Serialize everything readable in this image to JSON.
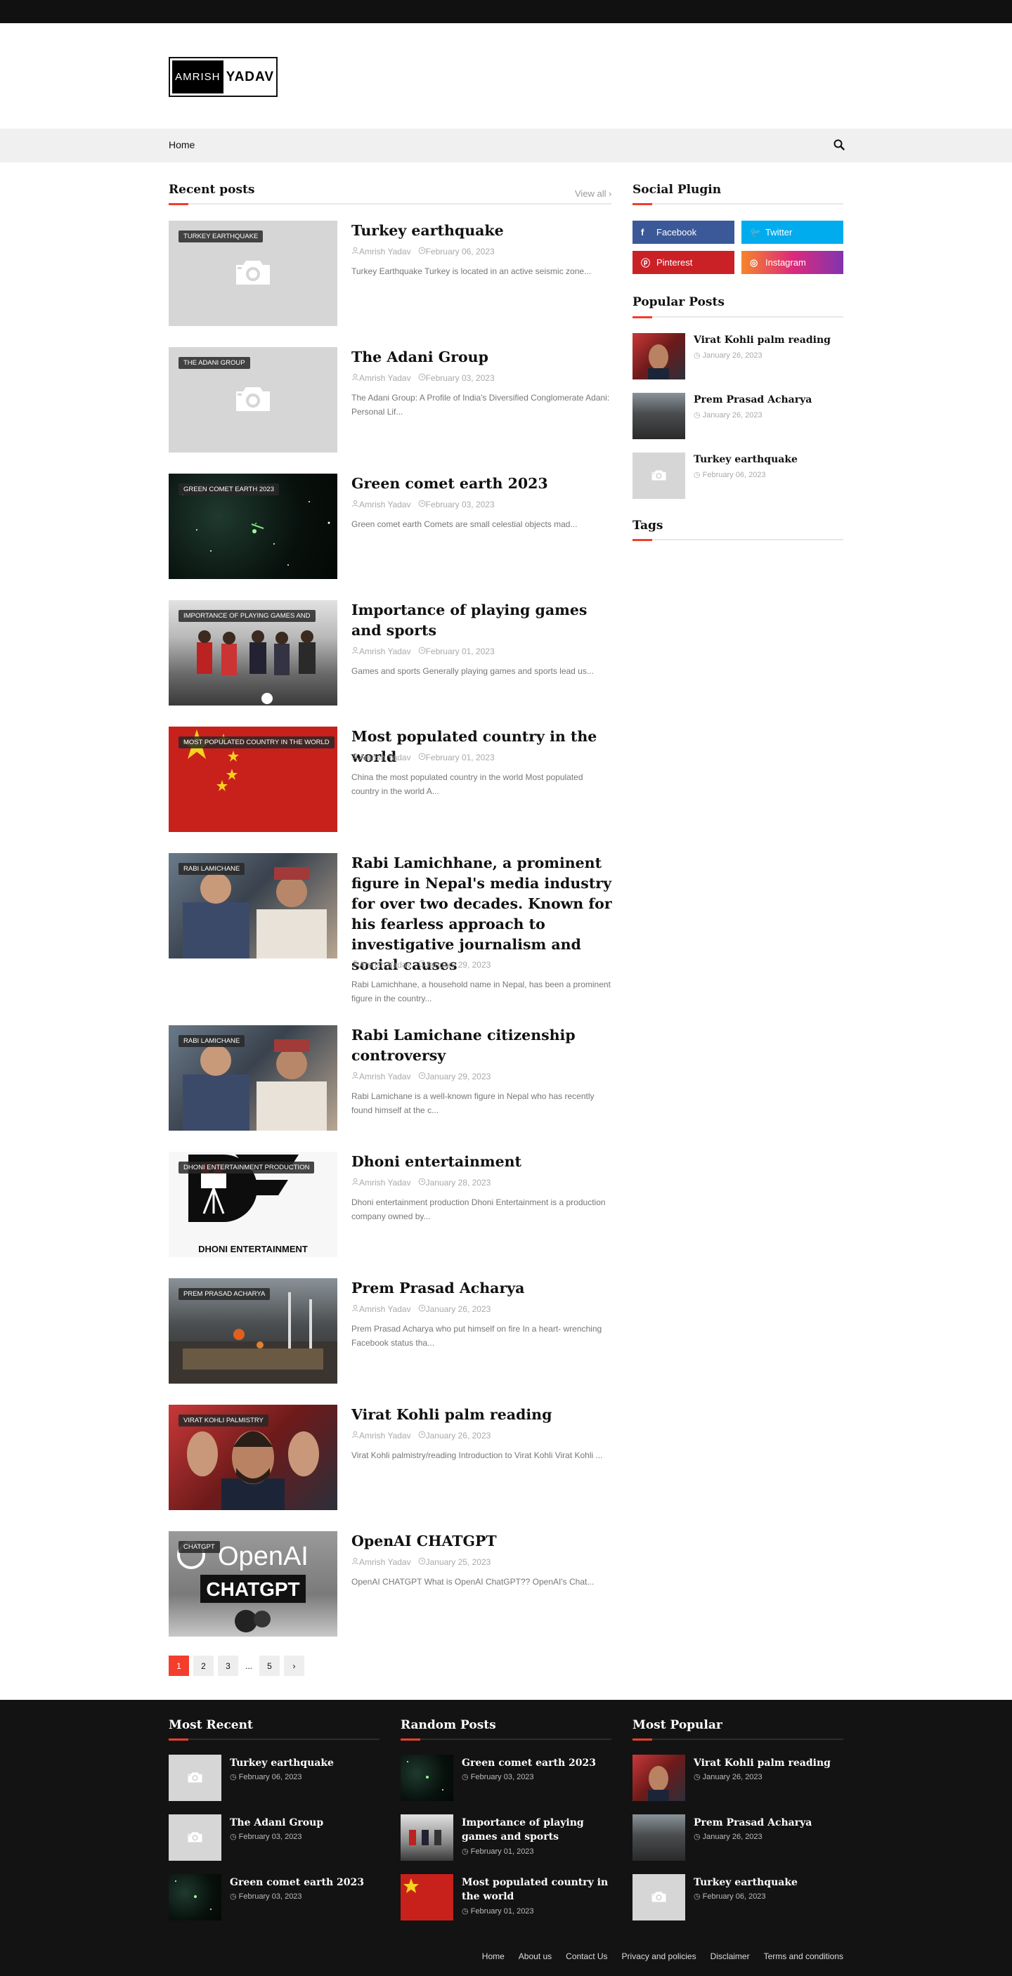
{
  "header": {
    "logo_part1": "AMRISH",
    "logo_part2": "YADAV"
  },
  "nav": {
    "home": "Home",
    "search_icon": "search-icon"
  },
  "recent": {
    "title": "Recent posts",
    "view_all": "View all",
    "posts": [
      {
        "badge": "Turkey earthquake",
        "title": "Turkey earthquake",
        "author": "Amrish Yadav",
        "date": "February 06, 2023",
        "excerpt": "Turkey Earthquake  Turkey is located in an active seismic zone..."
      },
      {
        "badge": "The Adani Group",
        "title": "The Adani Group",
        "author": "Amrish Yadav",
        "date": "February 03, 2023",
        "excerpt": "The Adani Group: A Profile of India's Diversified Conglomerate Adani: Personal Lif..."
      },
      {
        "badge": "Green comet earth 2023",
        "title": "Green comet earth 2023",
        "author": "Amrish Yadav",
        "date": "February 03, 2023",
        "excerpt": "Green comet earth   Comets are small celestial objects mad..."
      },
      {
        "badge": "Importance of playing games and",
        "title": "Importance of playing games and sports",
        "author": "Amrish Yadav",
        "date": "February 01, 2023",
        "excerpt": "Games and sports    Generally playing games and sports lead us..."
      },
      {
        "badge": "Most populated country in the world",
        "title": "Most populated country in the world",
        "author": "Amrish Yadav",
        "date": "February 01, 2023",
        "excerpt": "China the most populated country in the world  Most populated country in the world A..."
      },
      {
        "badge": "Rabi Lamichane",
        "title": "Rabi Lamichhane, a prominent figure in Nepal's media industry for over two decades. Known for his fearless approach to investigative journalism and social causes",
        "author": "Amrish Yadav",
        "date": "January 29, 2023",
        "excerpt": "Rabi Lamichhane, a household name in Nepal, has been a prominent figure in the country..."
      },
      {
        "badge": "Rabi Lamichane",
        "title": "Rabi Lamichane citizenship controversy",
        "author": "Amrish Yadav",
        "date": "January 29, 2023",
        "excerpt": "Rabi Lamichane is a well-known figure in Nepal who has recently found himself at the c..."
      },
      {
        "badge": "Dhoni entertainment production",
        "title": "Dhoni entertainment",
        "author": "Amrish Yadav",
        "date": "January 28, 2023",
        "excerpt": "Dhoni entertainment production  Dhoni Entertainment is a production company owned by..."
      },
      {
        "badge": "Prem Prasad Acharya",
        "title": "Prem Prasad Acharya",
        "author": "Amrish Yadav",
        "date": "January 26, 2023",
        "excerpt": "Prem Prasad Acharya who put himself on fire  In a heart- wrenching Facebook status tha..."
      },
      {
        "badge": "Virat kohli palmistry",
        "title": "Virat Kohli palm reading",
        "author": "Amrish Yadav",
        "date": "January 26, 2023",
        "excerpt": "Virat Kohli palmistry/reading Introduction to Virat Kohli Virat Kohli ..."
      },
      {
        "badge": "CHATGPT",
        "title": "OpenAI CHATGPT",
        "author": "Amrish Yadav",
        "date": "January 25, 2023",
        "excerpt": "OpenAI CHATGPT   What is OpenAI ChatGPT?? OpenAI's Chat..."
      }
    ],
    "dhoni_logo_text": "DHONI ENTERTAINMENT",
    "openai_text": "OpenAI",
    "chatgpt_text": "CHATGPT"
  },
  "pagination": [
    "1",
    "2",
    "3",
    "...",
    "5",
    "›"
  ],
  "sidebar": {
    "social_title": "Social Plugin",
    "social": [
      {
        "label": "Facebook",
        "color": "#3b5998"
      },
      {
        "label": "Twitter",
        "color": "#00acee"
      },
      {
        "label": "Pinterest",
        "color": "#ca2127"
      },
      {
        "label": "Instagram",
        "color": "#c13584"
      }
    ],
    "popular_title": "Popular Posts",
    "popular": [
      {
        "title": "Virat Kohli palm reading",
        "date": "January 26, 2023"
      },
      {
        "title": "Prem Prasad Acharya",
        "date": "January 26, 2023"
      },
      {
        "title": "Turkey earthquake",
        "date": "February 06, 2023"
      }
    ],
    "tags_title": "Tags"
  },
  "footer": {
    "most_recent_title": "Most Recent",
    "most_recent": [
      {
        "title": "Turkey earthquake",
        "date": "February 06, 2023"
      },
      {
        "title": "The Adani Group",
        "date": "February 03, 2023"
      },
      {
        "title": "Green comet earth 2023",
        "date": "February 03, 2023"
      }
    ],
    "random_title": "Random Posts",
    "random": [
      {
        "title": "Green comet earth 2023",
        "date": "February 03, 2023"
      },
      {
        "title": "Importance of playing games and sports",
        "date": "February 01, 2023"
      },
      {
        "title": "Most populated country in the world",
        "date": "February 01, 2023"
      }
    ],
    "most_popular_title": "Most Popular",
    "most_popular": [
      {
        "title": "Virat Kohli palm reading",
        "date": "January 26, 2023"
      },
      {
        "title": "Prem Prasad Acharya",
        "date": "January 26, 2023"
      },
      {
        "title": "Turkey earthquake",
        "date": "February 06, 2023"
      }
    ],
    "links": [
      "Home",
      "About us",
      "Contact Us",
      "Privacy and policies",
      "Disclaimer",
      "Terms and conditions"
    ]
  },
  "colors": {
    "accent": "#f33d2d",
    "footer_bg": "#131313"
  }
}
